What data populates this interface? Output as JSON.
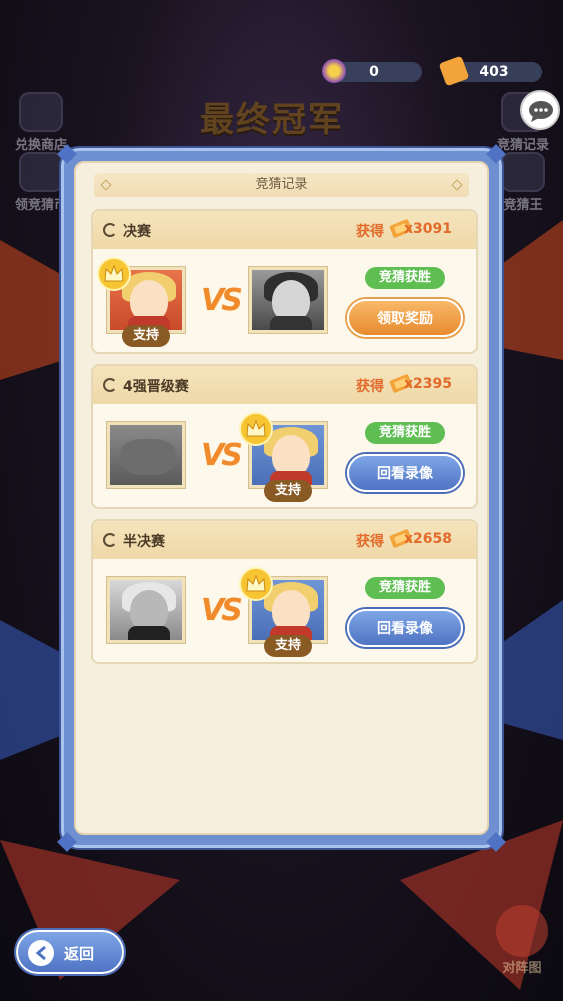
{
  "background": {
    "title": "最终冠军",
    "left_buttons": [
      {
        "label": "兑换商店",
        "icon": "shop-icon"
      },
      {
        "label": "领竞猜币",
        "icon": "coin-claim-icon"
      }
    ],
    "right_buttons": [
      {
        "label": "竞猜记录",
        "icon": "record-icon"
      },
      {
        "label": "竞猜王",
        "icon": "trophy-icon"
      }
    ],
    "team_button": "对阵图"
  },
  "currencies": [
    {
      "icon": "guess-coin-icon",
      "value": "0"
    },
    {
      "icon": "ticket-icon",
      "value": "403"
    }
  ],
  "panel": {
    "title": "竞猜记录",
    "records": [
      {
        "round": "决赛",
        "reward_label": "获得",
        "reward_amount": "x3091",
        "left_support": "支持",
        "right_support": "",
        "result": "竞猜获胜",
        "action": "领取奖励",
        "action_type": "claim"
      },
      {
        "round": "4强晋级赛",
        "reward_label": "获得",
        "reward_amount": "x2395",
        "left_support": "",
        "right_support": "支持",
        "result": "竞猜获胜",
        "action": "回看录像",
        "action_type": "replay"
      },
      {
        "round": "半决赛",
        "reward_label": "获得",
        "reward_amount": "x2658",
        "left_support": "",
        "right_support": "支持",
        "result": "竞猜获胜",
        "action": "回看录像",
        "action_type": "replay"
      }
    ],
    "vs": "VS"
  },
  "back_button": "返回",
  "colors": {
    "panel_frame": "#6e8fd0",
    "reward": "#e26a2a",
    "win_badge": "#5fbe52",
    "claim_button": "#e88a2e",
    "replay_button": "#4f74c4"
  }
}
